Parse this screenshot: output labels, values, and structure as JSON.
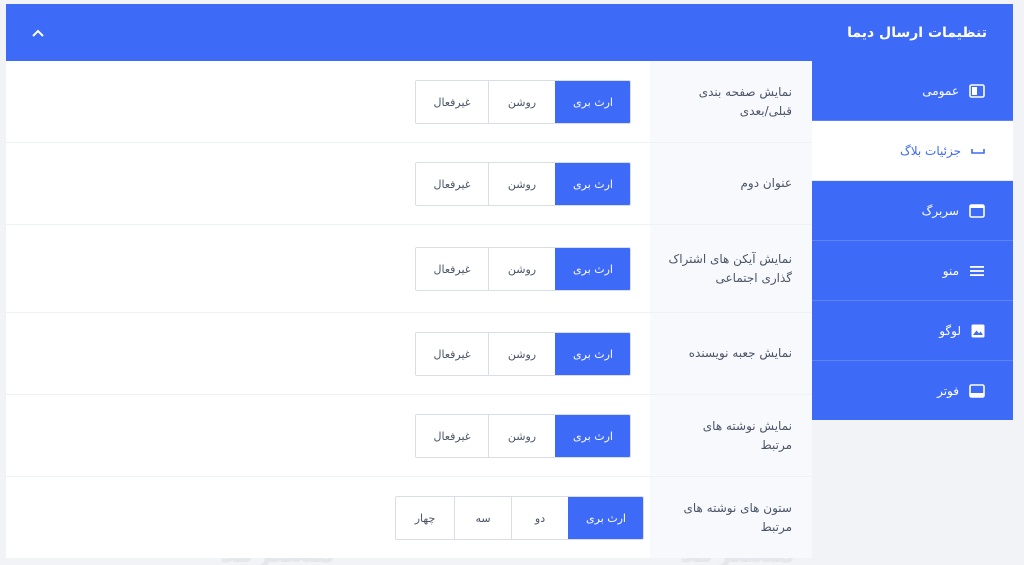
{
  "header": {
    "title": "تنظیمات ارسال دیما"
  },
  "sidebar": {
    "items": [
      {
        "label": "عمومی",
        "icon": "layout-icon",
        "active": false
      },
      {
        "label": "جزئیات بلاگ",
        "icon": "minus-icon",
        "active": true
      },
      {
        "label": "سربرگ",
        "icon": "window-icon",
        "active": false
      },
      {
        "label": "منو",
        "icon": "menu-icon",
        "active": false
      },
      {
        "label": "لوگو",
        "icon": "image-icon",
        "active": false
      },
      {
        "label": "فوتر",
        "icon": "footer-icon",
        "active": false
      }
    ]
  },
  "settings": [
    {
      "label": "نمایش صفحه بندی قبلی/بعدی",
      "options": [
        "ارث بری",
        "روشن",
        "غیرفعال"
      ],
      "selected": "ارث بری"
    },
    {
      "label": "عنوان دوم",
      "options": [
        "ارث بری",
        "روشن",
        "غیرفعال"
      ],
      "selected": "ارث بری"
    },
    {
      "label": "نمایش آیکن های اشتراک گذاری اجتماعی",
      "options": [
        "ارث بری",
        "روشن",
        "غیرفعال"
      ],
      "selected": "ارث بری"
    },
    {
      "label": "نمایش جعبه نویسنده",
      "options": [
        "ارث بری",
        "روشن",
        "غیرفعال"
      ],
      "selected": "ارث بری"
    },
    {
      "label": "نمایش نوشته های مرتبط",
      "options": [
        "ارث بری",
        "روشن",
        "غیرفعال"
      ],
      "selected": "ارث بری"
    },
    {
      "label": "ستون های نوشته های مرتبط",
      "options": [
        "ارث بری",
        "دو",
        "سه",
        "چهار"
      ],
      "selected": "ارث بری"
    }
  ],
  "watermark": {
    "text": "مسترکد"
  },
  "colors": {
    "accent": "#3d6af6",
    "label_bg": "#f8f9fc",
    "page_bg": "#f2f3f6"
  }
}
